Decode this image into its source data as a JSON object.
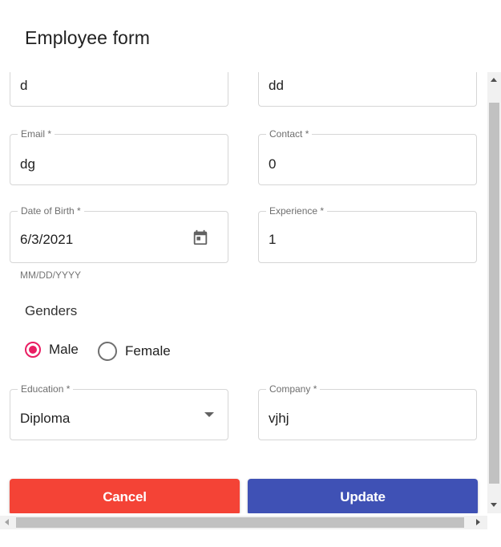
{
  "dialog": {
    "title": "Employee form"
  },
  "form": {
    "first_name": {
      "value": "d"
    },
    "last_name": {
      "value": "dd"
    },
    "email": {
      "label": "Email *",
      "value": "dg"
    },
    "contact": {
      "label": "Contact *",
      "value": "0"
    },
    "dob": {
      "label": "Date of Birth *",
      "value": "6/3/2021",
      "helper": "MM/DD/YYYY",
      "icon": "calendar-icon"
    },
    "experience": {
      "label": "Experience *",
      "value": "1"
    },
    "genders": {
      "label": "Genders",
      "options": [
        {
          "label": "Male",
          "checked": true
        },
        {
          "label": "Female",
          "checked": false
        }
      ]
    },
    "education": {
      "label": "Education *",
      "value": "Diploma",
      "icon": "chevron-down-icon"
    },
    "company": {
      "label": "Company *",
      "value": "vjhj"
    }
  },
  "actions": {
    "cancel": {
      "label": "Cancel",
      "color": "#f44336"
    },
    "update": {
      "label": "Update",
      "color": "#3f51b5"
    }
  },
  "theme": {
    "radio_accent": "#e91e63"
  }
}
